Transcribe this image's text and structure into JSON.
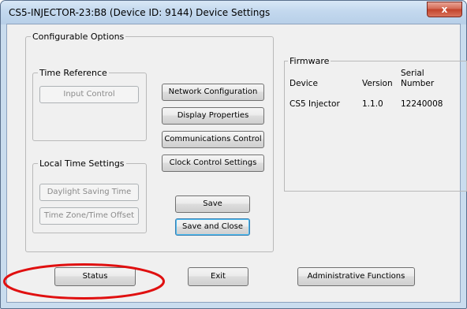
{
  "window": {
    "title": "CS5-INJECTOR-23:B8 (Device ID: 9144) Device Settings",
    "close_glyph": "x"
  },
  "configurable_options": {
    "label": "Configurable Options",
    "time_reference": {
      "label": "Time Reference",
      "input_control": "Input Control"
    },
    "local_time_settings": {
      "label": "Local Time Settings",
      "daylight_saving": "Daylight Saving Time",
      "time_zone": "Time Zone/Time Offset"
    },
    "buttons": {
      "network": "Network Configuration",
      "display": "Display Properties",
      "communications": "Communications Control",
      "clock": "Clock Control Settings",
      "save": "Save",
      "save_close": "Save and Close"
    }
  },
  "firmware": {
    "label": "Firmware",
    "columns": {
      "device": "Device",
      "version": "Version",
      "serial_line1": "Serial",
      "serial_line2": "Number"
    },
    "rows": [
      {
        "device": "CS5 Injector",
        "version": "1.1.0",
        "serial": "12240008"
      }
    ]
  },
  "bottom": {
    "status": "Status",
    "exit": "Exit",
    "admin": "Administrative Functions"
  },
  "annotation": {
    "color": "#e01010",
    "icon": "highlight-ellipse"
  }
}
